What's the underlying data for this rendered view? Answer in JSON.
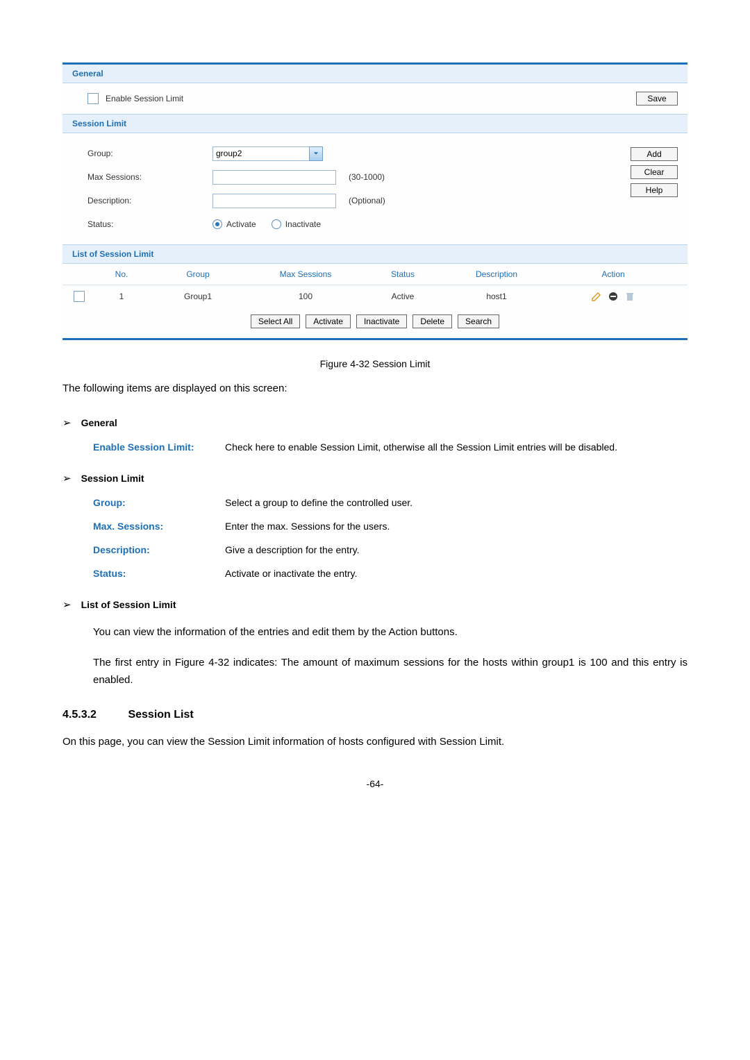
{
  "panel": {
    "general_title": "General",
    "enable_label": "Enable Session Limit",
    "save_btn": "Save",
    "session_limit_title": "Session Limit",
    "group_label": "Group:",
    "group_value": "group2",
    "max_sessions_label": "Max Sessions:",
    "max_sessions_hint": "(30-1000)",
    "description_label": "Description:",
    "description_hint": "(Optional)",
    "status_label": "Status:",
    "status_activate": "Activate",
    "status_inactivate": "Inactivate",
    "add_btn": "Add",
    "clear_btn": "Clear",
    "help_btn": "Help",
    "list_title": "List of Session Limit",
    "cols": {
      "no": "No.",
      "group": "Group",
      "max": "Max Sessions",
      "status": "Status",
      "desc": "Description",
      "action": "Action"
    },
    "row": {
      "no": "1",
      "group": "Group1",
      "max": "100",
      "status": "Active",
      "desc": "host1"
    },
    "btns": {
      "select_all": "Select All",
      "activate": "Activate",
      "inactivate": "Inactivate",
      "delete": "Delete",
      "search": "Search"
    }
  },
  "doc": {
    "fig_caption": "Figure 4-32 Session Limit",
    "intro": "The following items are displayed on this screen:",
    "sec_general": "General",
    "enable_term": "Enable Session Limit:",
    "enable_desc": "Check here to enable Session Limit, otherwise all the Session Limit entries will be disabled.",
    "sec_session_limit": "Session Limit",
    "group_term": "Group:",
    "group_desc": "Select a group to define the controlled user.",
    "max_term": "Max. Sessions:",
    "max_desc": "Enter the max. Sessions for the users.",
    "desc_term": "Description:",
    "desc_desc": "Give a description for the entry.",
    "status_term": "Status:",
    "status_desc": "Activate or inactivate the entry.",
    "sec_list": "List of Session Limit",
    "list_p1": "You can view the information of the entries and edit them by the Action buttons.",
    "list_p2": "The first entry in Figure 4-32 indicates: The amount of maximum sessions for the hosts within group1 is 100 and this entry is enabled.",
    "subheading_num": "4.5.3.2",
    "subheading_title": "Session List",
    "sublist_p": "On this page, you can view the Session Limit information of hosts configured with Session Limit.",
    "page_num": "-64-"
  }
}
